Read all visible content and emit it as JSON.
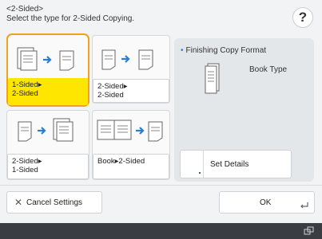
{
  "header": {
    "title": "<2-Sided>",
    "instruction": "Select the type for 2-Sided Copying."
  },
  "help": {
    "label": "?"
  },
  "options": [
    {
      "label_line1": "1-Sided▸",
      "label_line2": "2-Sided",
      "selected": true
    },
    {
      "label_line1": "2-Sided▸",
      "label_line2": "2-Sided",
      "selected": false
    },
    {
      "label_line1": "2-Sided▸",
      "label_line2": "1-Sided",
      "selected": false
    },
    {
      "label_line1": "Book▸2-Sided",
      "label_line2": "",
      "selected": false
    }
  ],
  "finishing": {
    "title": "Finishing Copy Format",
    "value": "Book Type",
    "set_details_label": "Set Details"
  },
  "footer": {
    "cancel_label": "Cancel Settings",
    "ok_label": "OK"
  },
  "colors": {
    "selected_border": "#f0a11d",
    "selected_fill": "#ffe600",
    "status_bar": "#3a3d42"
  }
}
